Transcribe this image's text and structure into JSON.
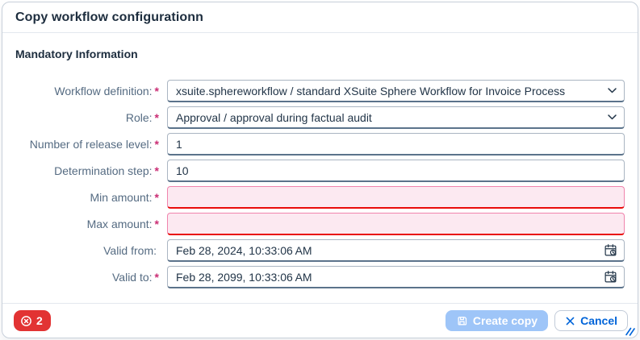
{
  "dialog": {
    "title": "Copy workflow configurationn",
    "section_title": "Mandatory Information",
    "fields": [
      {
        "label": "Workflow definition:",
        "required_marker": "*",
        "type": "select",
        "value": "xsuite.sphereworkflow / standard XSuite Sphere Workflow for Invoice Process"
      },
      {
        "label": "Role:",
        "required_marker": "*",
        "type": "select",
        "value": "Approval / approval during factual audit"
      },
      {
        "label": "Number of release level:",
        "required_marker": "*",
        "type": "text",
        "value": "1"
      },
      {
        "label": "Determination step:",
        "required_marker": "*",
        "type": "text",
        "value": "10"
      },
      {
        "label": "Min amount:",
        "required_marker": "*",
        "type": "text",
        "value": "",
        "state": "error"
      },
      {
        "label": "Max amount:",
        "required_marker": "*",
        "type": "text",
        "value": "",
        "state": "error"
      },
      {
        "label": "Valid from:",
        "required_marker": "",
        "type": "datetime",
        "value": "Feb 28, 2024, 10:33:06 AM"
      },
      {
        "label": "Valid to:",
        "required_marker": "*",
        "type": "datetime",
        "value": "Feb 28, 2099, 10:33:06 AM"
      }
    ],
    "footer": {
      "error_count": "2",
      "create_copy_label": "Create copy",
      "cancel_label": "Cancel"
    },
    "icons": {
      "dropdown": "chevron-down",
      "datetime_picker": "calendar-clock",
      "create_copy": "save-floppy",
      "cancel": "close-x",
      "messages": "error-circle-x",
      "corner": "resize-grip"
    },
    "colors": {
      "title_text": "#1d2d3e",
      "label_text": "#556b82",
      "required_asterisk": "#ca2d74",
      "field_border": "#aab5c2",
      "field_border_bottom": "#5b738b",
      "error_field_bg": "#fce9f1",
      "error_field_border": "#e90b0b",
      "error_badge_bg": "#e23333",
      "primary_disabled_bg": "#9ec5f8",
      "accent_blue": "#0064d9"
    }
  }
}
